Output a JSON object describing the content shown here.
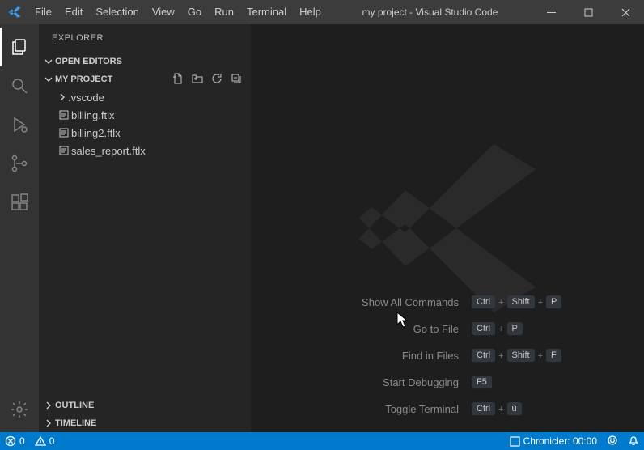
{
  "title": "my project - Visual Studio Code",
  "menu": [
    "File",
    "Edit",
    "Selection",
    "View",
    "Go",
    "Run",
    "Terminal",
    "Help"
  ],
  "explorer": {
    "title": "EXPLORER",
    "open_editors": "OPEN EDITORS",
    "project": "MY PROJECT",
    "folder": ".vscode",
    "files": [
      "billing.ftlx",
      "billing2.ftlx",
      "sales_report.ftlx"
    ],
    "outline": "OUTLINE",
    "timeline": "TIMELINE"
  },
  "shortcuts": [
    {
      "label": "Show All Commands",
      "keys": [
        "Ctrl",
        "Shift",
        "P"
      ]
    },
    {
      "label": "Go to File",
      "keys": [
        "Ctrl",
        "P"
      ]
    },
    {
      "label": "Find in Files",
      "keys": [
        "Ctrl",
        "Shift",
        "F"
      ]
    },
    {
      "label": "Start Debugging",
      "keys": [
        "F5"
      ]
    },
    {
      "label": "Toggle Terminal",
      "keys": [
        "Ctrl",
        "ù"
      ]
    }
  ],
  "status": {
    "errors": "0",
    "warnings": "0",
    "chronicler": "Chronicler: 00:00"
  }
}
